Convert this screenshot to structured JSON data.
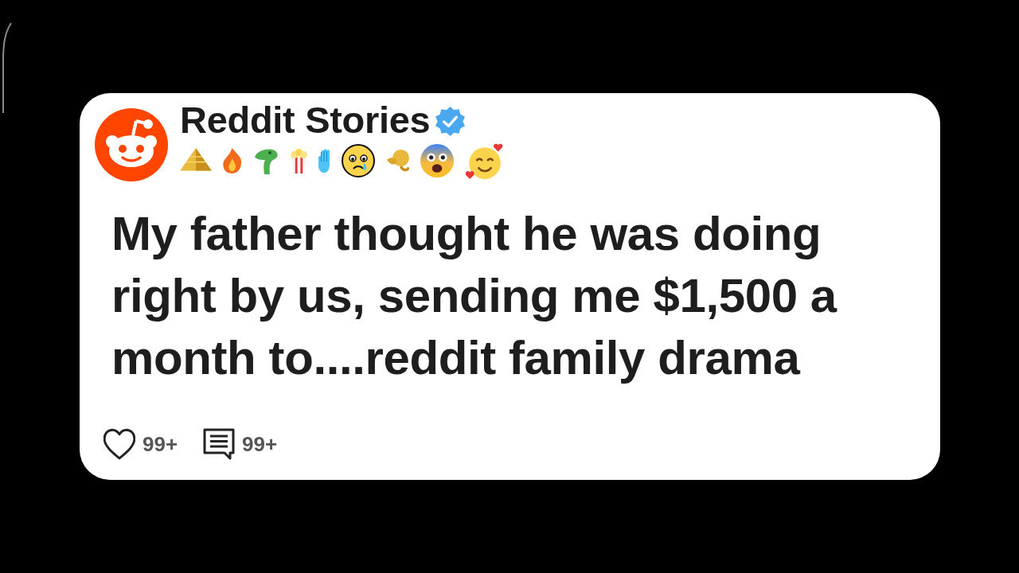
{
  "channel": {
    "name": "Reddit Stories",
    "verified": true
  },
  "post": {
    "title": "My father thought he was doing right by us, sending me $1,500 a month to....reddit family drama"
  },
  "stats": [
    {
      "kind": "likes",
      "count": "99+"
    },
    {
      "kind": "comments",
      "count": "99+"
    }
  ]
}
